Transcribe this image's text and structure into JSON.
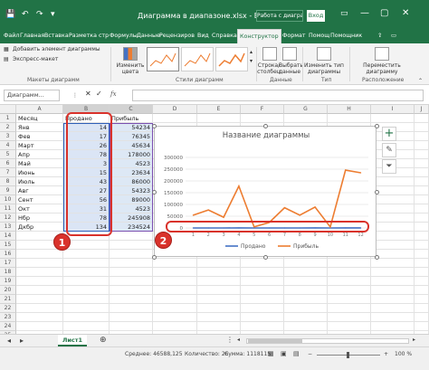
{
  "titlebar": {
    "title": "Диаграмма в диапазоне.xlsx  -  Excel",
    "work_chip": "Работа с диаграм...",
    "signin": "Вход",
    "window_controls": [
      "—",
      "▢",
      "✕"
    ]
  },
  "tabs": [
    {
      "label": "Файл"
    },
    {
      "label": "Главная"
    },
    {
      "label": "Вставка"
    },
    {
      "label": "Разметка стр"
    },
    {
      "label": "Формулы"
    },
    {
      "label": "Данные"
    },
    {
      "label": "Рецензиров"
    },
    {
      "label": "Вид"
    },
    {
      "label": "Справка"
    },
    {
      "label": "Конструктор"
    },
    {
      "label": "Формат"
    },
    {
      "label": "Помощ"
    },
    {
      "label": "Помощник"
    }
  ],
  "ribbon": {
    "add_element": "Добавить элемент диаграммы",
    "express_layout": "Экспресс-макет",
    "change_colors": "Изменить цвета",
    "group_layouts": "Макеты диаграмм",
    "group_styles": "Стили диаграмм",
    "row_col": "Строка/столбец",
    "select_data": "Выбрать данные",
    "group_data": "Данные",
    "change_type": "Изменить тип диаграммы",
    "group_type": "Тип",
    "move_chart": "Переместить диаграмму",
    "group_location": "Расположение"
  },
  "formula_bar": {
    "name_box": "Диаграмм...",
    "fx": "fx",
    "formula": ""
  },
  "columns": [
    "A",
    "B",
    "C",
    "D",
    "E",
    "F",
    "G",
    "H",
    "I",
    "J"
  ],
  "sheet": {
    "headers": [
      "Месяц",
      "Продано",
      "Прибыль"
    ],
    "rows": [
      {
        "month": "Янв",
        "sold": "14",
        "profit": "54234"
      },
      {
        "month": "Фев",
        "sold": "17",
        "profit": "76345"
      },
      {
        "month": "Март",
        "sold": "26",
        "profit": "45634"
      },
      {
        "month": "Апр",
        "sold": "78",
        "profit": "178000"
      },
      {
        "month": "Май",
        "sold": "3",
        "profit": "4523"
      },
      {
        "month": "Июнь",
        "sold": "15",
        "profit": "23634"
      },
      {
        "month": "Июль",
        "sold": "43",
        "profit": "86000"
      },
      {
        "month": "Авг",
        "sold": "27",
        "profit": "54323"
      },
      {
        "month": "Сент",
        "sold": "56",
        "profit": "89000"
      },
      {
        "month": "Окт",
        "sold": "31",
        "profit": "4523"
      },
      {
        "month": "Нбр",
        "sold": "78",
        "profit": "245908"
      },
      {
        "month": "Дкбр",
        "sold": "134",
        "profit": "234524"
      }
    ],
    "row_numbers": [
      "1",
      "2",
      "3",
      "4",
      "5",
      "6",
      "7",
      "8",
      "9",
      "10",
      "11",
      "12",
      "13",
      "14",
      "15",
      "16",
      "17",
      "18",
      "19",
      "20",
      "21",
      "22",
      "23",
      "24",
      "25"
    ]
  },
  "chart_data": {
    "type": "line",
    "title": "Название диаграммы",
    "categories": [
      "1",
      "2",
      "3",
      "4",
      "5",
      "6",
      "7",
      "8",
      "9",
      "10",
      "11",
      "12"
    ],
    "series": [
      {
        "name": "Продано",
        "values": [
          14,
          17,
          26,
          78,
          3,
          15,
          43,
          27,
          56,
          31,
          78,
          134
        ],
        "color": "#4472c4"
      },
      {
        "name": "Прибыль",
        "values": [
          54234,
          76345,
          45634,
          178000,
          4523,
          23634,
          86000,
          54323,
          89000,
          4523,
          245908,
          234524
        ],
        "color": "#ed7d31"
      }
    ],
    "yticks": [
      "300000",
      "250000",
      "200000",
      "150000",
      "100000",
      "50000",
      "0"
    ],
    "ylim": [
      0,
      300000
    ],
    "legend": "bottom",
    "grid": true
  },
  "callouts": {
    "one": "1",
    "two": "2"
  },
  "sheet_tab": "Лист1",
  "status": {
    "average": "Среднее: 46588,125",
    "count": "Количество: 26",
    "sum": "Сумма: 1118115",
    "zoom": "100 %"
  },
  "colors": {
    "excel_green": "#217346",
    "callout_red": "#d9322b",
    "series_blue": "#4472c4",
    "series_orange": "#ed7d31"
  }
}
